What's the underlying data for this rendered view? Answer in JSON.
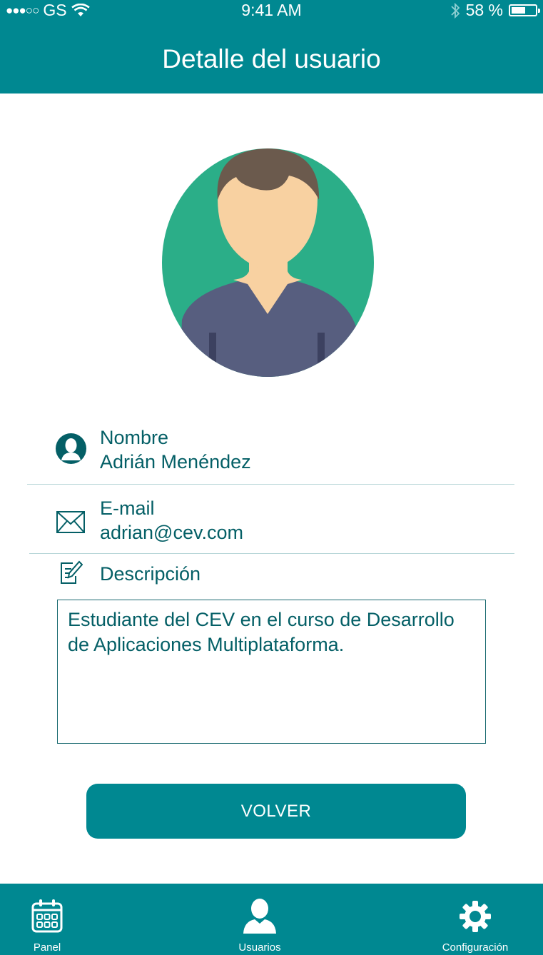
{
  "status": {
    "carrier": "GS",
    "time": "9:41 AM",
    "battery": "58 %",
    "battery_level": 0.58
  },
  "header": {
    "title": "Detalle del usuario"
  },
  "user": {
    "name_label": "Nombre",
    "name_value": "Adrián Menéndez",
    "email_label": "E-mail",
    "email_value": "adrian@cev.com",
    "description_label": "Descripción",
    "description_value": "Estudiante del CEV en el curso de Desarrollo de Aplicaciones Multiplataforma."
  },
  "actions": {
    "back_label": "VOLVER"
  },
  "tabs": [
    {
      "label": "Panel",
      "icon": "calendar-icon"
    },
    {
      "label": "Usuarios",
      "icon": "user-icon"
    },
    {
      "label": "Configuración",
      "icon": "gear-icon"
    }
  ],
  "colors": {
    "primary": "#008891",
    "text": "#045f66",
    "avatar_bg": "#2bae88",
    "shirt": "#575e7f",
    "skin": "#f8d1a1",
    "hair": "#6b5a4d"
  }
}
